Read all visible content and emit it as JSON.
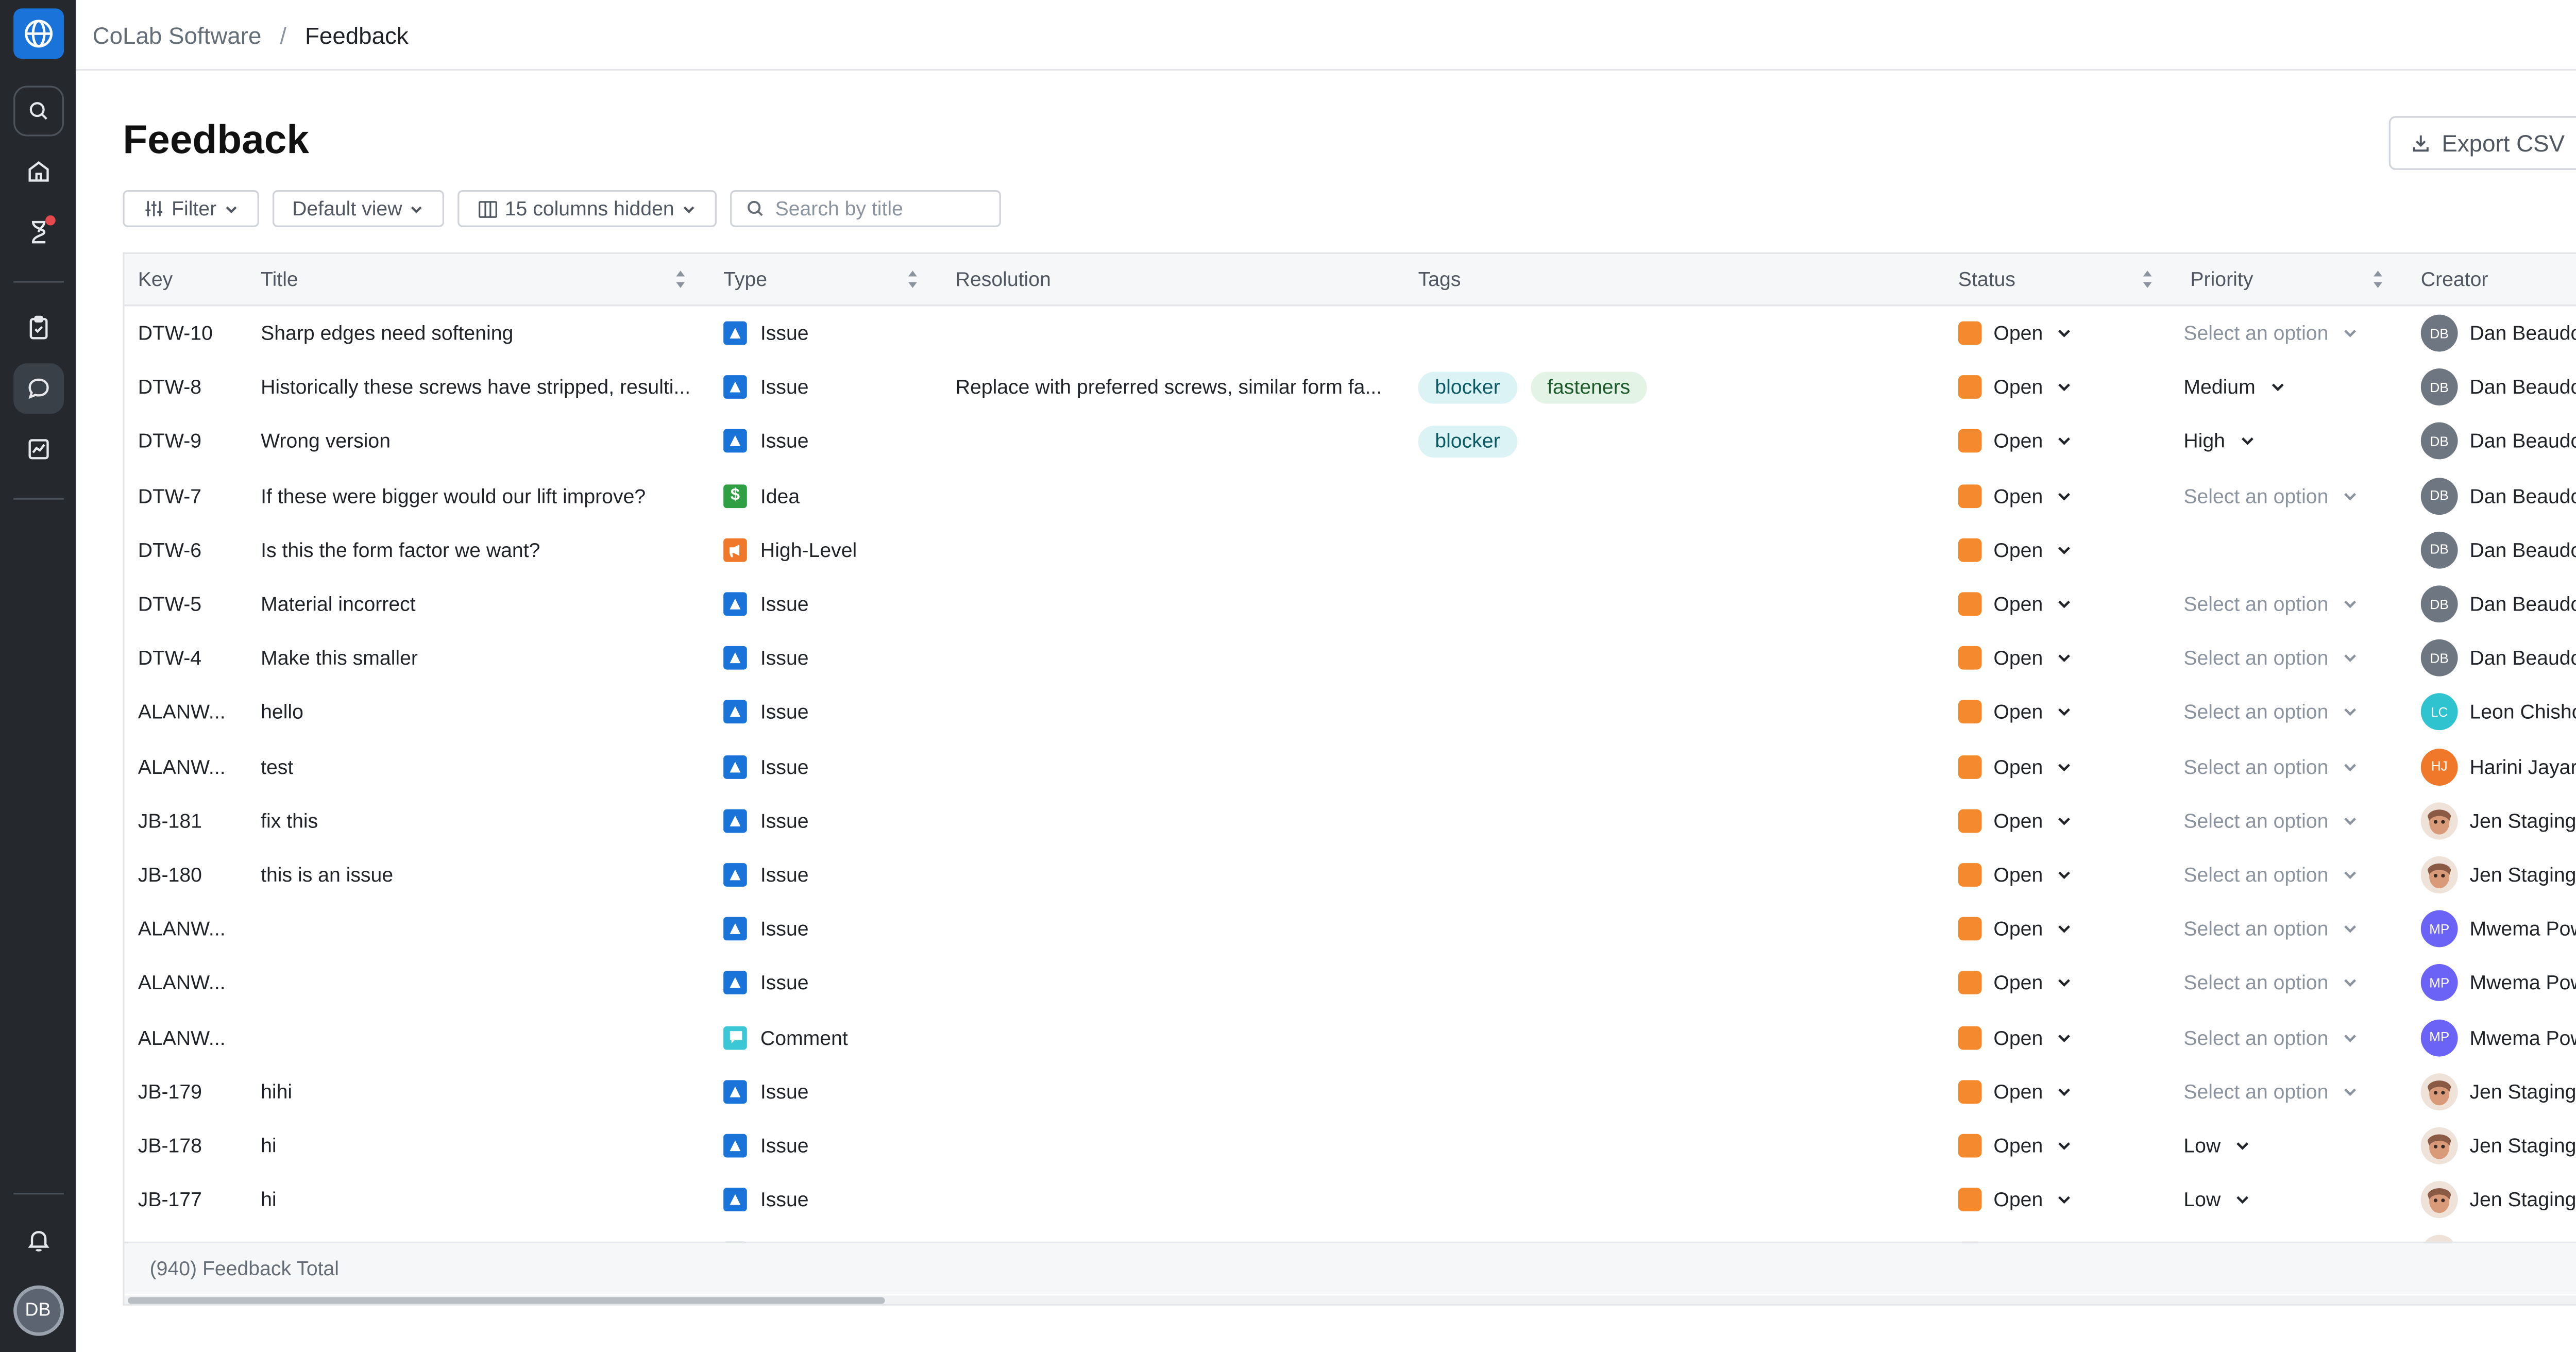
{
  "breadcrumb": {
    "org": "CoLab Software",
    "separator": "/",
    "current": "Feedback"
  },
  "page": {
    "title": "Feedback",
    "export_label": "Export CSV"
  },
  "toolbar": {
    "filter_label": "Filter",
    "view_label": "Default view",
    "columns_label": "15 columns hidden",
    "search_placeholder": "Search by title"
  },
  "columns": {
    "key": "Key",
    "title": "Title",
    "type": "Type",
    "resolution": "Resolution",
    "tags": "Tags",
    "status": "Status",
    "priority": "Priority",
    "creator": "Creator"
  },
  "rows": [
    {
      "key": "DTW-10",
      "title": "Sharp edges need softening",
      "type": "Issue",
      "resolution": "",
      "tags": [],
      "status": "Open",
      "priority": "Select an option",
      "creator": "Dan Beaudoin",
      "initials": "DB"
    },
    {
      "key": "DTW-8",
      "title": "Historically these screws have stripped, resulti...",
      "type": "Issue",
      "resolution": "Replace with preferred screws, similar form fa...",
      "tags": [
        "blocker",
        "fasteners"
      ],
      "status": "Open",
      "priority": "Medium",
      "creator": "Dan Beaudoin",
      "initials": "DB"
    },
    {
      "key": "DTW-9",
      "title": "Wrong version",
      "type": "Issue",
      "resolution": "",
      "tags": [
        "blocker"
      ],
      "status": "Open",
      "priority": "High",
      "creator": "Dan Beaudoin",
      "initials": "DB"
    },
    {
      "key": "DTW-7",
      "title": "If these were bigger would our lift improve?",
      "type": "Idea",
      "resolution": "",
      "tags": [],
      "status": "Open",
      "priority": "Select an option",
      "creator": "Dan Beaudoin",
      "initials": "DB"
    },
    {
      "key": "DTW-6",
      "title": "Is this the form factor we want?",
      "type": "High-Level",
      "resolution": "",
      "tags": [],
      "status": "Open",
      "priority": "",
      "creator": "Dan Beaudoin",
      "initials": "DB"
    },
    {
      "key": "DTW-5",
      "title": "Material incorrect",
      "type": "Issue",
      "resolution": "",
      "tags": [],
      "status": "Open",
      "priority": "Select an option",
      "creator": "Dan Beaudoin",
      "initials": "DB"
    },
    {
      "key": "DTW-4",
      "title": "Make this smaller",
      "type": "Issue",
      "resolution": "",
      "tags": [],
      "status": "Open",
      "priority": "Select an option",
      "creator": "Dan Beaudoin",
      "initials": "DB"
    },
    {
      "key": "ALANW...",
      "title": "hello",
      "type": "Issue",
      "resolution": "",
      "tags": [],
      "status": "Open",
      "priority": "Select an option",
      "creator": "Leon Chisholm",
      "initials": "LC"
    },
    {
      "key": "ALANW...",
      "title": "test",
      "type": "Issue",
      "resolution": "",
      "tags": [],
      "status": "Open",
      "priority": "Select an option",
      "creator": "Harini Jayaraman",
      "initials": "HJ"
    },
    {
      "key": "JB-181",
      "title": "fix this",
      "type": "Issue",
      "resolution": "",
      "tags": [],
      "status": "Open",
      "priority": "Select an option",
      "creator": "Jen Staging",
      "initials": ""
    },
    {
      "key": "JB-180",
      "title": "this is an issue",
      "type": "Issue",
      "resolution": "",
      "tags": [],
      "status": "Open",
      "priority": "Select an option",
      "creator": "Jen Staging",
      "initials": ""
    },
    {
      "key": "ALANW...",
      "title": "",
      "type": "Issue",
      "resolution": "",
      "tags": [],
      "status": "Open",
      "priority": "Select an option",
      "creator": "Mwema Powa",
      "initials": "MP"
    },
    {
      "key": "ALANW...",
      "title": "",
      "type": "Issue",
      "resolution": "",
      "tags": [],
      "status": "Open",
      "priority": "Select an option",
      "creator": "Mwema Powa",
      "initials": "MP"
    },
    {
      "key": "ALANW...",
      "title": "",
      "type": "Comment",
      "resolution": "",
      "tags": [],
      "status": "Open",
      "priority": "Select an option",
      "creator": "Mwema Powa",
      "initials": "MP"
    },
    {
      "key": "JB-179",
      "title": "hihi",
      "type": "Issue",
      "resolution": "",
      "tags": [],
      "status": "Open",
      "priority": "Select an option",
      "creator": "Jen Staging",
      "initials": ""
    },
    {
      "key": "JB-178",
      "title": "hi",
      "type": "Issue",
      "resolution": "",
      "tags": [],
      "status": "Open",
      "priority": "Low",
      "creator": "Jen Staging",
      "initials": ""
    },
    {
      "key": "JB-177",
      "title": "hi",
      "type": "Issue",
      "resolution": "",
      "tags": [],
      "status": "Open",
      "priority": "Low",
      "creator": "Jen Staging",
      "initials": ""
    }
  ],
  "footer": {
    "total": "(940) Feedback Total"
  },
  "user": {
    "initials": "DB"
  },
  "icons": {
    "issue": "triangle-icon",
    "idea": "dollar-icon",
    "high_level": "megaphone-icon",
    "comment": "comment-icon",
    "status": "status-square-icon"
  },
  "colors": {
    "brand": "#1a73d9",
    "rail": "#25292e",
    "status_open": "#f48a2d",
    "issue": "#1a73d9",
    "idea": "#2ea043",
    "high_level": "#f0782a",
    "comment": "#3cc7d6",
    "avatar_db": "#6e7681",
    "avatar_lc": "#2fc2cf",
    "avatar_hj": "#f0782a",
    "avatar_mp": "#6b63f5"
  }
}
